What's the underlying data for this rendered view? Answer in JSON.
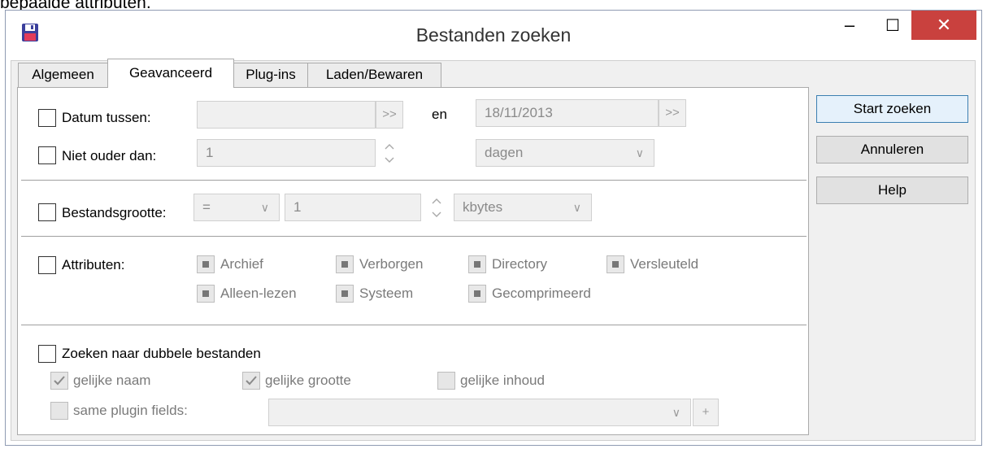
{
  "caption_text": "bepaalde attributen.",
  "window": {
    "title": "Bestanden zoeken",
    "icon": "floppy-disk-icon",
    "controls": {
      "minimize": "–",
      "maximize": "☐",
      "close": "✕"
    }
  },
  "tabs": [
    {
      "label": "Algemeen",
      "active": false
    },
    {
      "label": "Geavanceerd",
      "active": true
    },
    {
      "label": "Plug-ins",
      "active": false
    },
    {
      "label": "Laden/Bewaren",
      "active": false
    }
  ],
  "date": {
    "checkbox_label": "Datum tussen:",
    "checked": false,
    "from_value": "",
    "picker_label": ">>",
    "and_label": "en",
    "to_value": "18/11/2013"
  },
  "age": {
    "checkbox_label": "Niet ouder dan:",
    "checked": false,
    "value": "1",
    "unit": "dagen"
  },
  "size": {
    "checkbox_label": "Bestandsgrootte:",
    "checked": false,
    "operator": "=",
    "value": "1",
    "unit": "kbytes"
  },
  "attributes": {
    "checkbox_label": "Attributen:",
    "checked": false,
    "row1": [
      "Archief",
      "Verborgen",
      "Directory",
      "Versleuteld"
    ],
    "row2": [
      "Alleen-lezen",
      "Systeem",
      "Gecomprimeerd"
    ]
  },
  "duplicates": {
    "checkbox_label": "Zoeken naar dubbele bestanden",
    "checked": false,
    "same_name": {
      "label": "gelijke naam",
      "checked": true
    },
    "same_size": {
      "label": "gelijke grootte",
      "checked": true
    },
    "same_content": {
      "label": "gelijke inhoud",
      "checked": false
    },
    "plugin_fields": {
      "label": "same plugin fields:",
      "checked": false,
      "value": ""
    },
    "add_label": "+"
  },
  "buttons": {
    "start": "Start zoeken",
    "cancel": "Annuleren",
    "help": "Help"
  },
  "colors": {
    "close_button": "#c9413e",
    "default_button_border": "#3c7fb1"
  }
}
